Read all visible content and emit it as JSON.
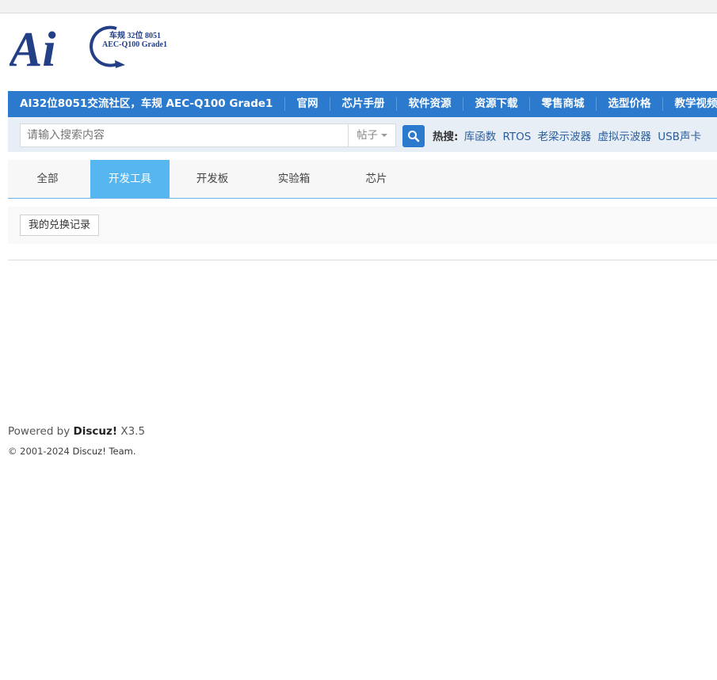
{
  "logo": {
    "big_letters": "Ai",
    "line1": "车规 32位 8051",
    "line2": "AEC-Q100 Grade1"
  },
  "nav": {
    "items": [
      "AI32位8051交流社区，车规 AEC-Q100 Grade1",
      "官网",
      "芯片手册",
      "软件资源",
      "资源下载",
      "零售商城",
      "选型价格",
      "教学视频"
    ]
  },
  "search": {
    "placeholder": "请输入搜索内容",
    "type_selected": "帖子",
    "hot_label": "热搜:",
    "hot_links": [
      "库函数",
      "RTOS",
      "老梁示波器",
      "虚拟示波器",
      "USB声卡"
    ]
  },
  "tabs": {
    "items": [
      "全部",
      "开发工具",
      "开发板",
      "实验箱",
      "芯片"
    ],
    "active_index": 1
  },
  "panel": {
    "record_button": "我的兑换记录"
  },
  "footer": {
    "powered_prefix": "Powered by ",
    "powered_brand": "Discuz!",
    "powered_version": " X3.5",
    "copyright_prefix": "© 2001-2024 ",
    "copyright_link": "Discuz! Team."
  },
  "colors": {
    "nav_bg": "#2b7acd",
    "tab_active": "#56b7f0",
    "link": "#2b5d9c"
  }
}
